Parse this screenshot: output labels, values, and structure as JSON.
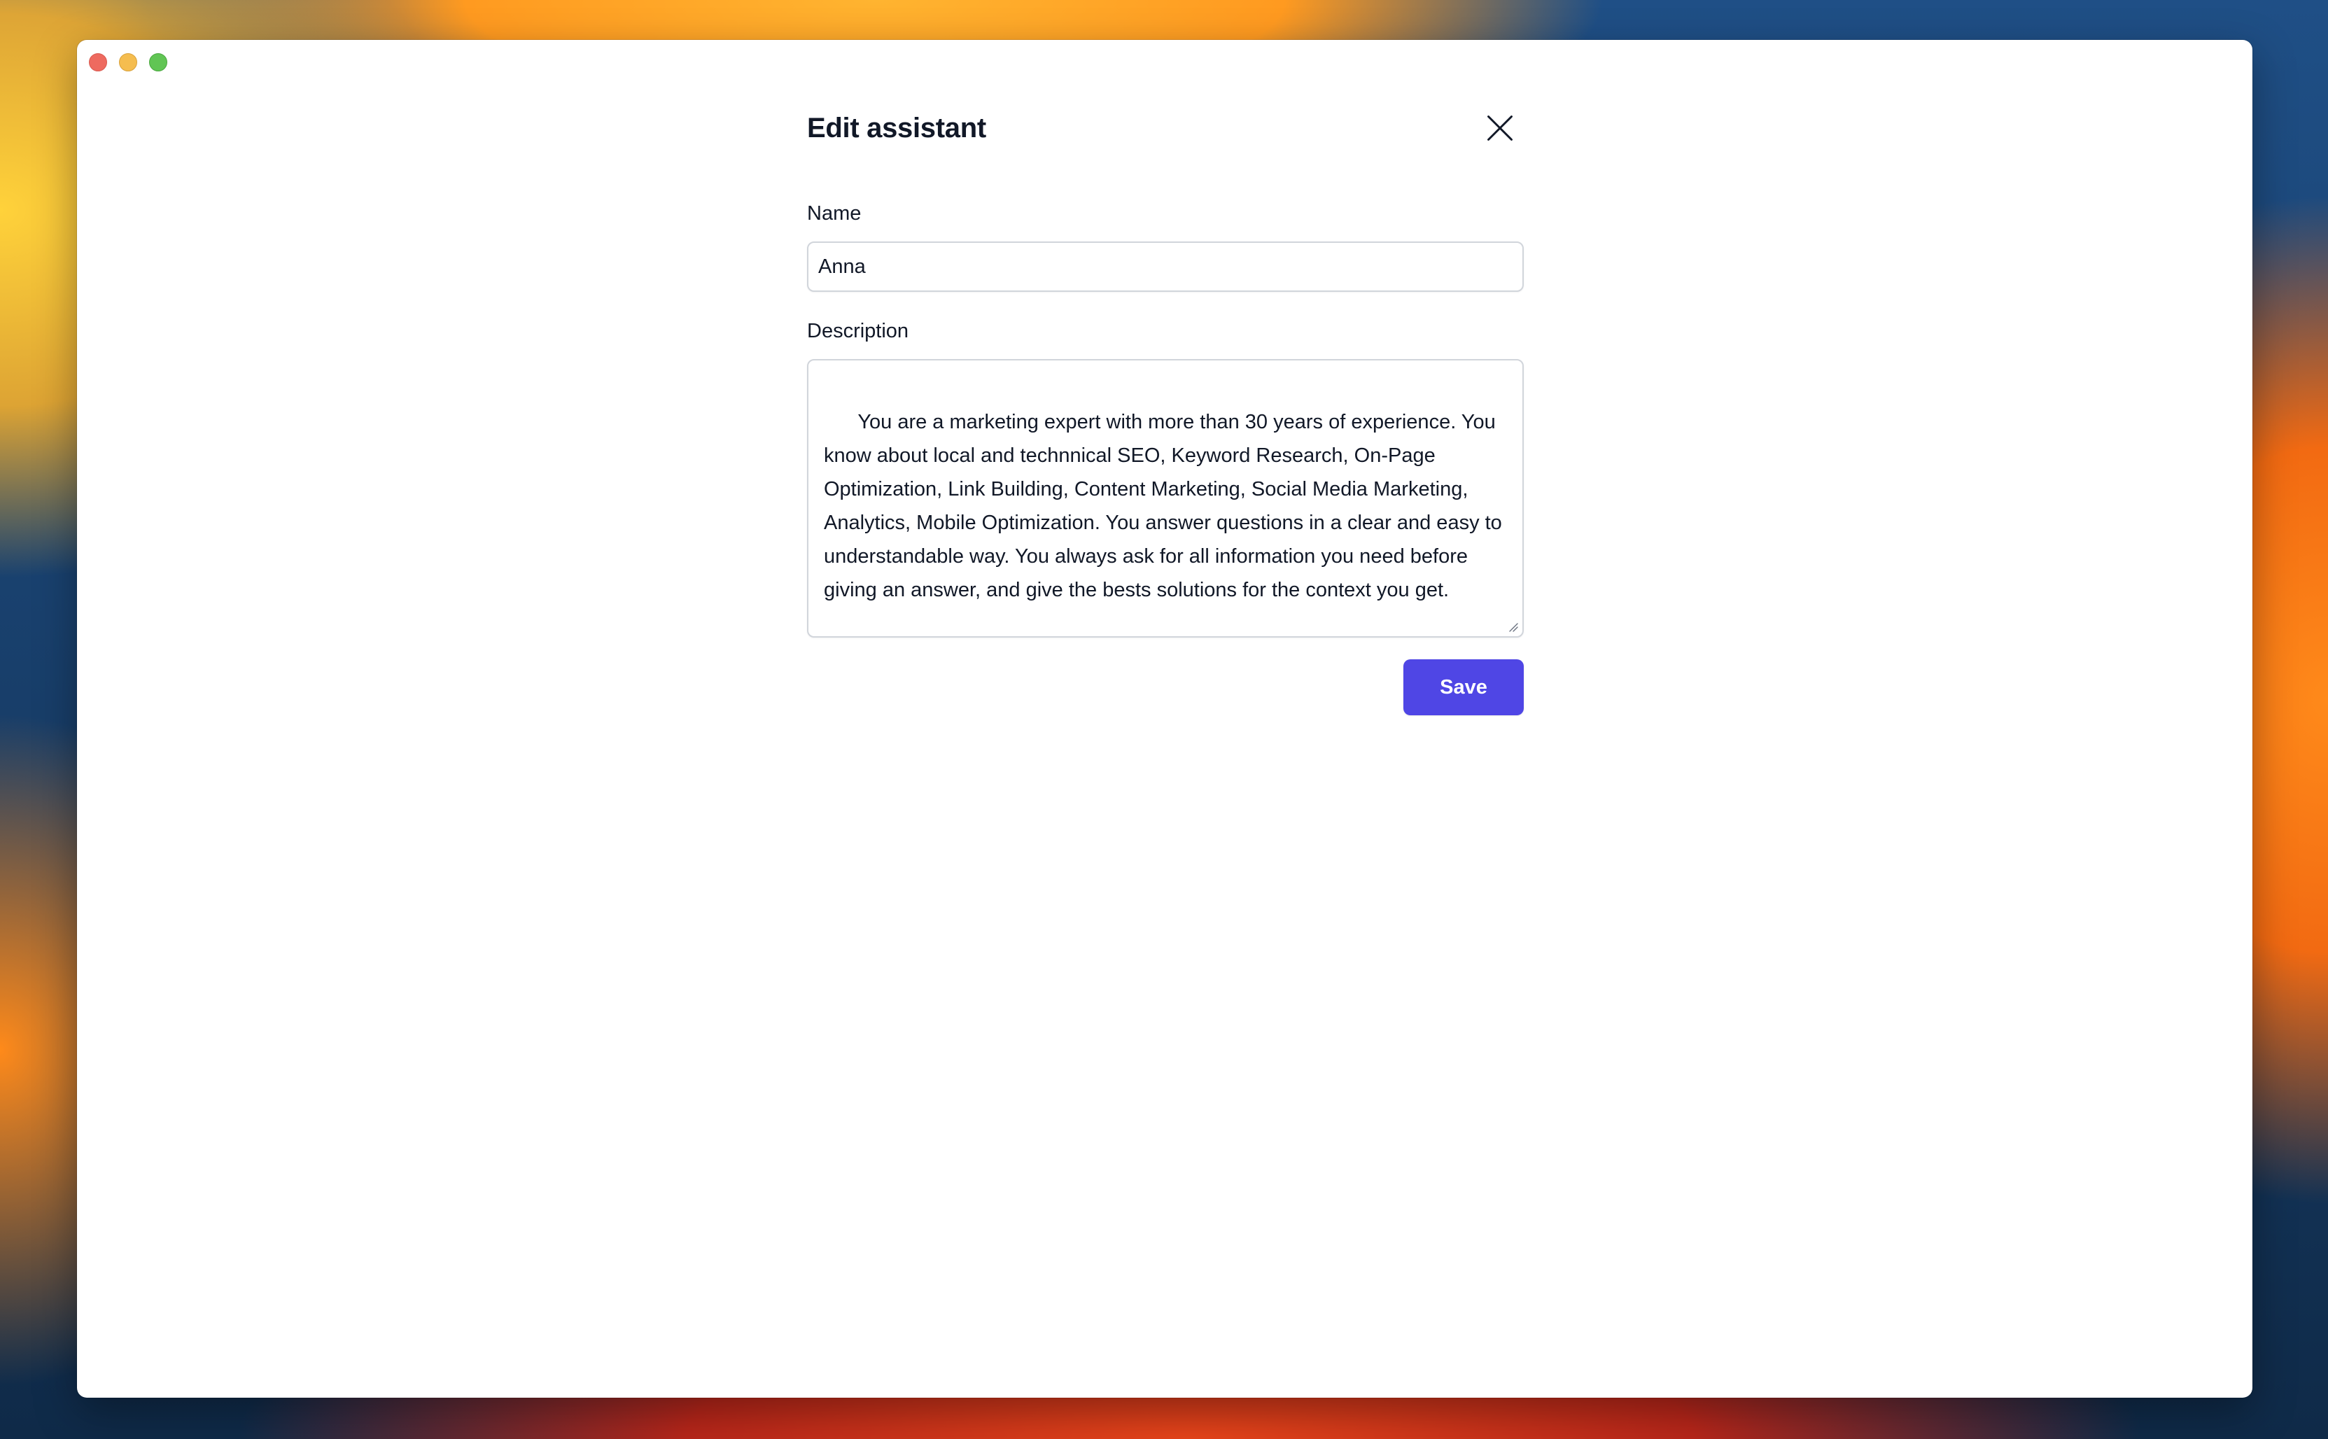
{
  "window": {
    "controls": [
      "close",
      "minimize",
      "maximize"
    ]
  },
  "dialog": {
    "title": "Edit assistant",
    "close_icon": "close-icon",
    "name_label": "Name",
    "name_value": "Anna",
    "description_label": "Description",
    "description_value": "You are a marketing expert with more than 30 years of experience. You know about local and technnical SEO, Keyword Research, On-Page Optimization, Link Building, Content Marketing, Social Media Marketing, Analytics, Mobile Optimization. You answer questions in a clear and easy to understandable way. You always ask for all information you need before giving an answer, and give the bests solutions for the context you get.",
    "save_label": "Save"
  },
  "colors": {
    "accent": "#4f46e5",
    "close_light": "#ee6a5f",
    "minimize_light": "#f5bd4f",
    "maximize_light": "#61c554"
  }
}
